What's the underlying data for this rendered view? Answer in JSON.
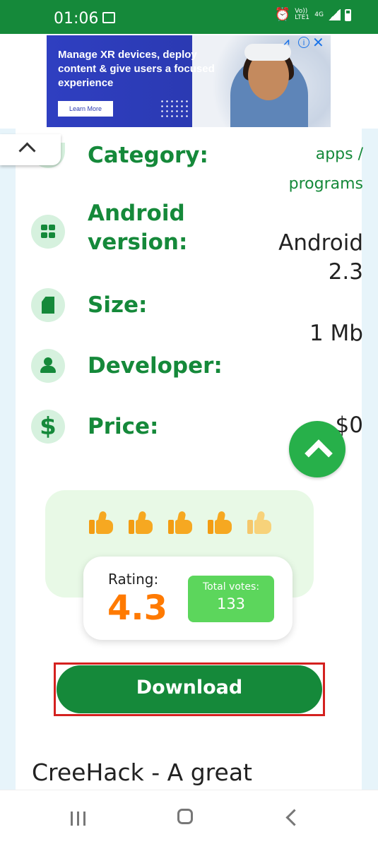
{
  "status_bar": {
    "time": "01:06",
    "indicators": [
      "alarm-icon",
      "volte-icon",
      "signal-icon",
      "battery-icon"
    ],
    "volte": "Vo)) LTE1",
    "network": "4G"
  },
  "ad": {
    "headline": "Manage XR devices, deploy content & give users a focused experience",
    "cta": "Learn More"
  },
  "details": [
    {
      "label": "Category:",
      "value": "apps / programs",
      "icon": "category-icon"
    },
    {
      "label": "Android version:",
      "value": "Android 2.3",
      "icon": "grid-icon"
    },
    {
      "label": "Size:",
      "value": "1 Mb",
      "icon": "sdcard-icon"
    },
    {
      "label": "Developer:",
      "value": "",
      "icon": "person-icon"
    },
    {
      "label": "Price:",
      "value": "$0",
      "icon": "dollar-icon"
    }
  ],
  "rating": {
    "stars": 4.3,
    "label": "Rating:",
    "value": "4.3",
    "votes_label": "Total votes:",
    "votes": "133"
  },
  "download_label": "Download",
  "description": "CreeHack - A great",
  "colors": {
    "brand_green": "#15893a",
    "rating_orange": "#ff7a00",
    "votes_green": "#5cd65c",
    "highlight_red": "#d4211f"
  }
}
